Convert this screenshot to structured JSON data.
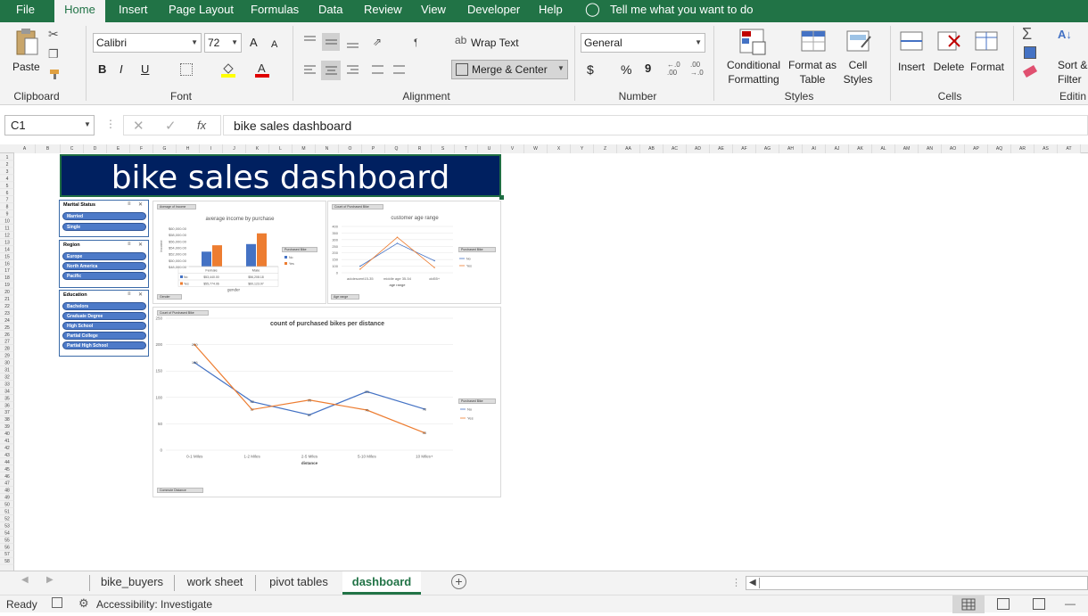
{
  "menu": {
    "tabs": [
      "File",
      "Home",
      "Insert",
      "Page Layout",
      "Formulas",
      "Data",
      "Review",
      "View",
      "Developer",
      "Help"
    ],
    "active": "Home",
    "tell_me": "Tell me what you want to do"
  },
  "ribbon": {
    "clipboard": {
      "paste": "Paste",
      "label": "Clipboard"
    },
    "font": {
      "name": "Calibri",
      "size": "72",
      "bold": "B",
      "italic": "I",
      "underline": "U",
      "label": "Font",
      "grow": "A",
      "shrink": "A"
    },
    "alignment": {
      "wrap": "Wrap Text",
      "merge": "Merge & Center",
      "label": "Alignment"
    },
    "number": {
      "format": "General",
      "currency": "$",
      "percent": "%",
      "comma": "9",
      "label": "Number",
      "inc": "←.0\n.00",
      "dec": ".00\n→.0"
    },
    "styles": {
      "conditional": "Conditional\nFormatting",
      "format_table": "Format as\nTable",
      "cell_styles": "Cell\nStyles",
      "label": "Styles"
    },
    "cells": {
      "insert": "Insert",
      "delete": "Delete",
      "format": "Format",
      "label": "Cells"
    },
    "editing": {
      "sort": "Sort &\nFilter",
      "label": "Editin"
    }
  },
  "formula_bar": {
    "name_box": "C1",
    "fx": "fx",
    "content": "bike sales dashboard"
  },
  "columns": [
    "A",
    "B",
    "C",
    "D",
    "E",
    "F",
    "G",
    "H",
    "I",
    "J",
    "K",
    "L",
    "M",
    "N",
    "O",
    "P",
    "Q",
    "R",
    "S",
    "T",
    "U",
    "V",
    "W",
    "X",
    "Y",
    "Z",
    "AA",
    "AB",
    "AC",
    "AD",
    "AE",
    "AF",
    "AG",
    "AH",
    "AI",
    "AJ",
    "AK",
    "AL",
    "AM",
    "AN",
    "AO",
    "AP",
    "AQ",
    "AR",
    "AS",
    "AT"
  ],
  "dashboard": {
    "title": "bike sales dashboard",
    "title_bg": "#002060",
    "slicers": [
      {
        "title": "Marital Status",
        "items": [
          "Married",
          "Single"
        ]
      },
      {
        "title": "Region",
        "items": [
          "Europe",
          "North America",
          "Pacific"
        ]
      },
      {
        "title": "Education",
        "items": [
          "Bachelors",
          "Graduate Degree",
          "High School",
          "Partial College",
          "Partial High School"
        ]
      }
    ]
  },
  "charts": {
    "income": {
      "field": "Average of Income",
      "axis_field": "Gender",
      "legend_field": "Purchased Bike"
    },
    "age": {
      "field": "Count of Purchased Bike",
      "axis_field": "Age range",
      "legend_field": "Purchased Bike"
    },
    "distance": {
      "field": "Count of Purchased Bike",
      "axis_field": "Commute Distance",
      "legend_field": "Purchased Bike"
    }
  },
  "chart_data": [
    {
      "type": "bar",
      "title": "average income by purchase",
      "xlabel": "gender",
      "ylabel": "Income",
      "categories": [
        "Female",
        "Male"
      ],
      "series": [
        {
          "name": "No",
          "values": [
            53440,
            56208
          ],
          "table_labels": [
            "$53,440.00",
            "$56,208.18"
          ],
          "color": "#4472c4"
        },
        {
          "name": "Yes",
          "values": [
            55774,
            60124
          ],
          "table_labels": [
            "$55,774.06",
            "$60,123.97"
          ],
          "color": "#ed7d31"
        }
      ],
      "ylim": [
        48000,
        62000
      ],
      "yticks": [
        "$48,000.00",
        "$50,000.00",
        "$52,000.00",
        "$54,000.00",
        "$56,000.00",
        "$58,000.00",
        "$60,000.00"
      ]
    },
    {
      "type": "line",
      "title": "customer age range",
      "xlabel": "age range",
      "categories": [
        "adolescent15-35",
        "middle age 35-54",
        "old55+"
      ],
      "series": [
        {
          "name": "No",
          "values": [
            71,
            318,
            130
          ],
          "color": "#4472c4"
        },
        {
          "name": "Yes",
          "values": [
            39,
            383,
            56
          ],
          "color": "#ed7d31"
        }
      ],
      "ylim": [
        0,
        500
      ],
      "yticks": [
        "0",
        "100",
        "150",
        "200",
        "250",
        "300",
        "350",
        "400"
      ]
    },
    {
      "type": "line",
      "title": "count of purchased bikes per distance",
      "xlabel": "distance",
      "categories": [
        "0-1 Miles",
        "1-2 Miles",
        "2-5 Miles",
        "5-10 Miles",
        "10 Miles+"
      ],
      "series": [
        {
          "name": "No",
          "values": [
            166,
            92,
            67,
            111,
            78
          ],
          "color": "#4472c4"
        },
        {
          "name": "Yes",
          "values": [
            200,
            77,
            95,
            76,
            33
          ],
          "color": "#ed7d31"
        }
      ],
      "ylim": [
        0,
        250
      ],
      "yticks": [
        "0",
        "50",
        "100",
        "150",
        "200",
        "250"
      ]
    }
  ],
  "sheet_tabs": [
    "bike_buyers",
    "work sheet",
    "pivot tables",
    "dashboard"
  ],
  "active_sheet": "dashboard",
  "status": {
    "ready": "Ready",
    "accessibility": "Accessibility: Investigate"
  }
}
